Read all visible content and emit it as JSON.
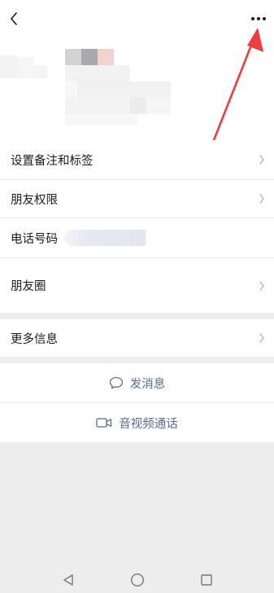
{
  "header": {
    "back_icon": "chevron-left-icon",
    "more_icon": "more-horizontal-icon"
  },
  "rows": {
    "remarks_tags": "设置备注和标签",
    "friend_permissions": "朋友权限",
    "phone_label": "电话号码",
    "moments": "朋友圈",
    "more_info": "更多信息"
  },
  "actions": {
    "send_message": "发消息",
    "video_call": "音视频通话"
  },
  "colors": {
    "link": "#576b95",
    "annotation": "#f03c3c",
    "background": "#ededed"
  }
}
